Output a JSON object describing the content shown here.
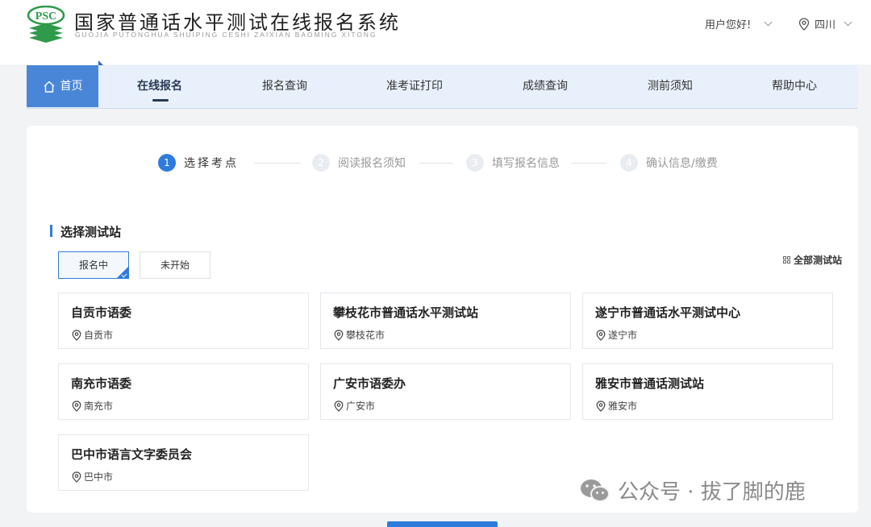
{
  "header": {
    "logo_text": "PSC",
    "title": "国家普通话水平测试在线报名系统",
    "subtitle": "GUOJIA PUTONGHUA SHUIPING CESHI ZAIXIAN BAOMING XITONG",
    "user_greeting": "用户您好!",
    "location": "四川"
  },
  "nav": {
    "items": [
      "首页",
      "在线报名",
      "报名查询",
      "准考证打印",
      "成绩查询",
      "测前须知",
      "帮助中心"
    ],
    "active": "在线报名"
  },
  "steps": [
    {
      "num": "1",
      "label": "选择考点"
    },
    {
      "num": "2",
      "label": "阅读报名须知"
    },
    {
      "num": "3",
      "label": "填写报名信息"
    },
    {
      "num": "4",
      "label": "确认信息/缴费"
    }
  ],
  "section": {
    "title": "选择测试站",
    "filters": [
      "报名中",
      "未开始"
    ],
    "all_stations": "全部测试站"
  },
  "stations": [
    {
      "name": "自贡市语委",
      "city": "自贡市"
    },
    {
      "name": "攀枝花市普通话水平测试站",
      "city": "攀枝花市"
    },
    {
      "name": "遂宁市普通话水平测试中心",
      "city": "遂宁市"
    },
    {
      "name": "南充市语委",
      "city": "南充市"
    },
    {
      "name": "广安市语委办",
      "city": "广安市"
    },
    {
      "name": "雅安市普通话测试站",
      "city": "雅安市"
    },
    {
      "name": "巴中市语言文字委员会",
      "city": "巴中市"
    }
  ],
  "watermark": "公众号 · 拔了脚的鹿",
  "colors": {
    "accent": "#2f7bdc",
    "nav_bg": "#e8f1fb",
    "home_bg": "#4a86d8",
    "logo_green": "#2e9a4a"
  }
}
